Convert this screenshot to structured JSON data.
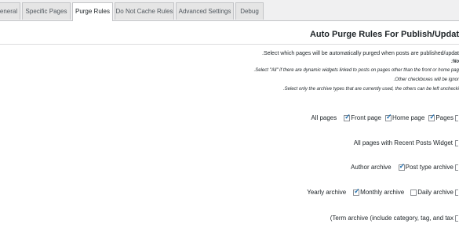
{
  "tabs": [
    {
      "label": "eneral"
    },
    {
      "label": "Specific Pages"
    },
    {
      "label": "Purge Rules"
    },
    {
      "label": "Do Not Cache Rules"
    },
    {
      "label": "Advanced Settings"
    },
    {
      "label": "Debug"
    }
  ],
  "active_tab": "Purge Rules",
  "page_title": "Auto Purge Rules For Publish/Updat",
  "description": {
    "main": ".Select which pages will be automatically purged when posts are published/updat",
    "note": ":No",
    "line1": ".Select \"All\" if there are dynamic widgets linked to posts on pages other than the front or home pag",
    "line2": ".Other checkboxes will be ignor",
    "line3": ".Select only the archive types that are currently used, the others can be left unchecki"
  },
  "rows": {
    "all_pages": {
      "label": "All pages",
      "options": [
        {
          "label": "Front page",
          "checked": true
        },
        {
          "label": "Home page",
          "checked": true
        },
        {
          "label": "Pages",
          "checked": true
        }
      ]
    },
    "recent_posts": {
      "label": "All pages with Recent Posts Widget",
      "checked": false
    },
    "author_archive": {
      "label": "Author archive",
      "options": [
        {
          "label": "Post type archive",
          "checked": true
        }
      ]
    },
    "yearly_archive": {
      "label": "Yearly archive",
      "options": [
        {
          "label": "Monthly archive",
          "checked": true
        },
        {
          "label": "Daily archive",
          "checked": false
        }
      ]
    },
    "term_archive": {
      "label": "(Term archive (include category, tag, and tax"
    }
  },
  "colors": {
    "accent": "#2271b1",
    "tab_border": "#c3c4c7"
  }
}
